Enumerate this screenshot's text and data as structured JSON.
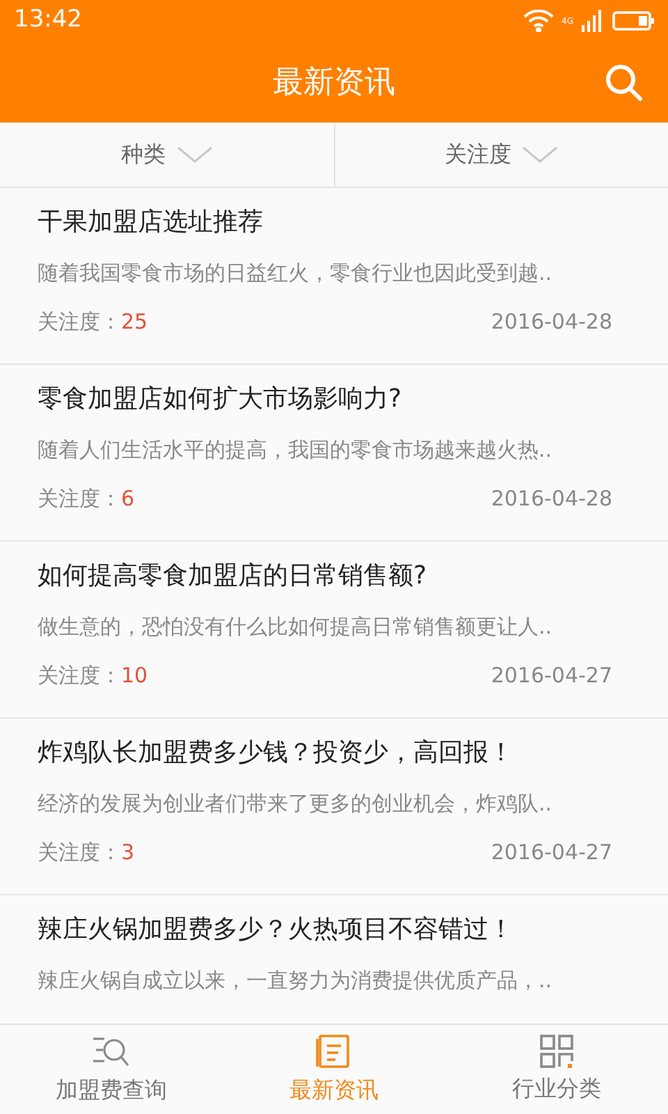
{
  "status_bar": {
    "time": "13:42",
    "network": "4G"
  },
  "header": {
    "title": "最新资讯"
  },
  "filters": [
    {
      "label": "种类"
    },
    {
      "label": "关注度"
    }
  ],
  "articles": [
    {
      "title": "干果加盟店选址推荐",
      "summary": "随着我国零食市场的日益红火，零食行业也因此受到越..",
      "attention_label": "关注度：",
      "attention": "25",
      "date": "2016-04-28"
    },
    {
      "title": "零食加盟店如何扩大市场影响力?",
      "summary": "随着人们生活水平的提高，我国的零食市场越来越火热..",
      "attention_label": "关注度：",
      "attention": "6",
      "date": "2016-04-28"
    },
    {
      "title": "如何提高零食加盟店的日常销售额?",
      "summary": "做生意的，恐怕没有什么比如何提高日常销售额更让人..",
      "attention_label": "关注度：",
      "attention": "10",
      "date": "2016-04-27"
    },
    {
      "title": "炸鸡队长加盟费多少钱？投资少，高回报！",
      "summary": "经济的发展为创业者们带来了更多的创业机会，炸鸡队..",
      "attention_label": "关注度：",
      "attention": "3",
      "date": "2016-04-27"
    },
    {
      "title": "辣庄火锅加盟费多少？火热项目不容错过！",
      "summary": "辣庄火锅自成立以来，一直努力为消费提供优质产品，.."
    }
  ],
  "bottom_nav": [
    {
      "label": "加盟费查询",
      "kind": "search",
      "selected": false
    },
    {
      "label": "最新资讯",
      "kind": "news",
      "selected": true
    },
    {
      "label": "行业分类",
      "kind": "grid",
      "selected": false
    }
  ]
}
